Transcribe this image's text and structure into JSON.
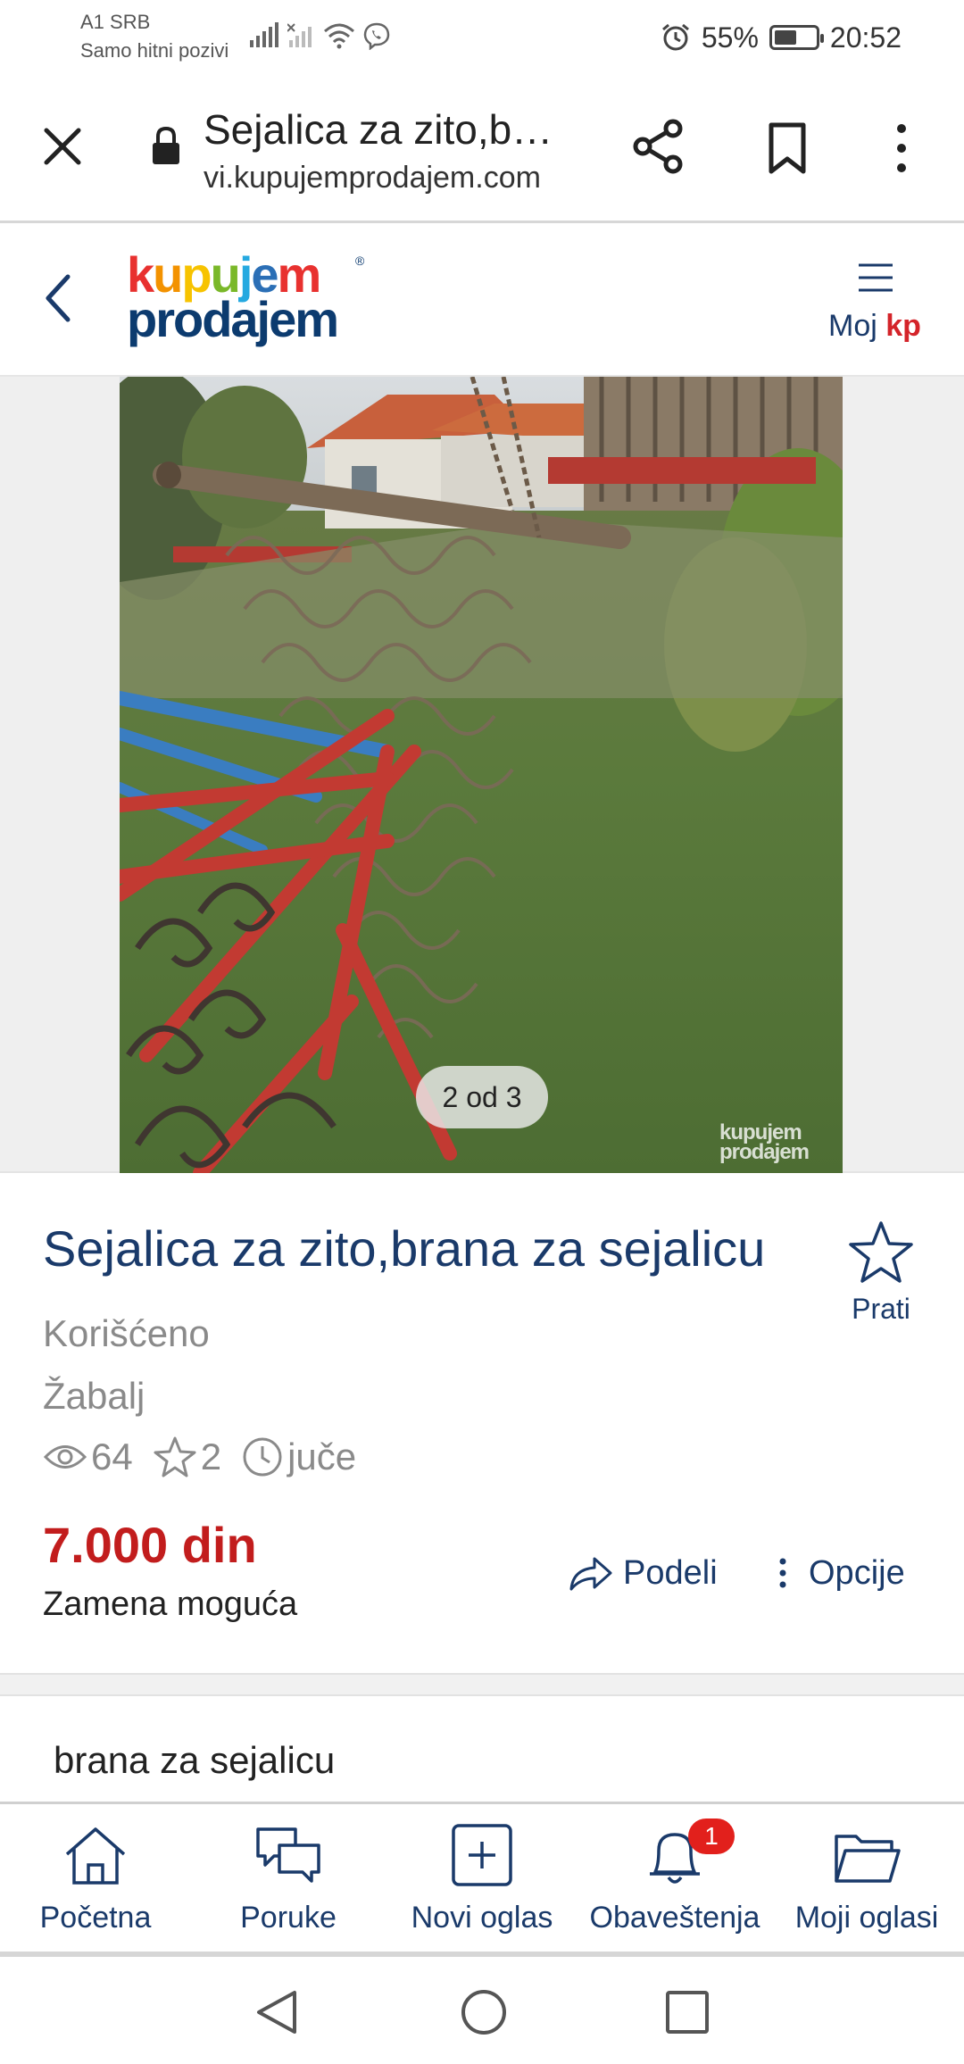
{
  "status_bar": {
    "carrier": "A1 SRB",
    "carrier_note": "Samo hitni pozivi",
    "battery": "55%",
    "battery_level": 0.55,
    "time": "20:52"
  },
  "browser": {
    "page_title": "Sejalica za zito,b…",
    "url": "vi.kupujemprodajem.com"
  },
  "site": {
    "logo_top": "kupujem",
    "logo_bottom": "prodajem",
    "logo_top_colors": [
      "#e8312f",
      "#f39200",
      "#f7c300",
      "#7ab829",
      "#25a9e0",
      "#2b6fb6",
      "#e8312f"
    ],
    "menu_label": "Moj ",
    "menu_label_brand": "kp"
  },
  "gallery": {
    "counter": "2 od 3",
    "watermark_top": "kupujem",
    "watermark_bottom": "prodajem"
  },
  "ad": {
    "title": "Sejalica za zito,brana za sejalicu",
    "follow_label": "Prati",
    "condition": "Korišćeno",
    "location": "Žabalj",
    "views": "64",
    "favorites": "2",
    "posted": "juče",
    "price": "7.000 din",
    "exchange": "Zamena moguća",
    "share_label": "Podeli",
    "options_label": "Opcije",
    "description": "brana za sejalicu"
  },
  "bottom_nav": {
    "items": [
      {
        "label": "Početna",
        "icon": "home-icon"
      },
      {
        "label": "Poruke",
        "icon": "messages-icon"
      },
      {
        "label": "Novi oglas",
        "icon": "add-ad-icon"
      },
      {
        "label": "Obaveštenja",
        "icon": "bell-icon",
        "badge": "1"
      },
      {
        "label": "Moji oglasi",
        "icon": "folder-icon"
      }
    ]
  },
  "colors": {
    "brand_blue": "#1a3a6a",
    "price_red": "#c21d1d",
    "badge_red": "#e2201c"
  }
}
